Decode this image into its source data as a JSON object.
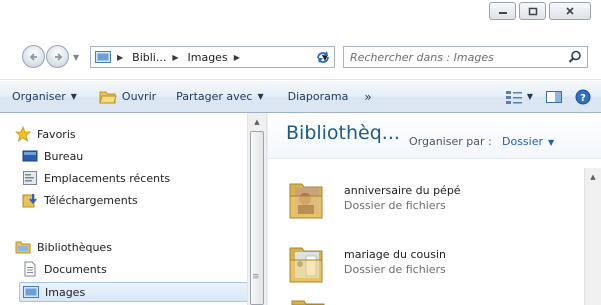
{
  "address": {
    "crumbs": [
      "Bibli...",
      "Images"
    ],
    "search_placeholder": "Rechercher dans : Images"
  },
  "toolbar": {
    "organiser": "Organiser",
    "ouvrir": "Ouvrir",
    "partager": "Partager avec",
    "diaporama": "Diaporama",
    "more": "»"
  },
  "nav": {
    "favoris": "Favoris",
    "bureau": "Bureau",
    "emplacements": "Emplacements récents",
    "telechargements": "Téléchargements",
    "bibliotheques": "Bibliothèques",
    "documents": "Documents",
    "images": "Images"
  },
  "content": {
    "title": "Bibliothèq...",
    "arrange_label": "Organiser par :",
    "arrange_value": "Dossier",
    "items": [
      {
        "name": "anniversaire du pépé",
        "type": "Dossier de fichiers"
      },
      {
        "name": "mariage du cousin",
        "type": "Dossier de fichiers"
      }
    ]
  },
  "colors": {
    "accent": "#1d5a8c",
    "toolbar_text": "#1e395b",
    "link": "#1f5fae"
  }
}
